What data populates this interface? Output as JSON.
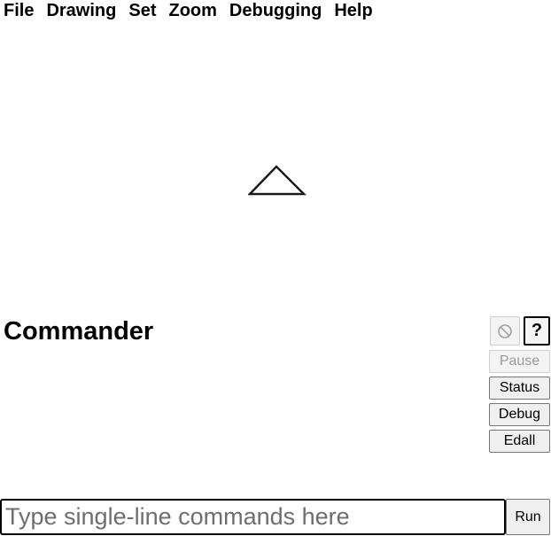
{
  "menubar": {
    "items": [
      "File",
      "Drawing",
      "Set",
      "Zoom",
      "Debugging",
      "Help"
    ]
  },
  "canvas": {
    "turtle_icon": "turtle-triangle-icon"
  },
  "commander": {
    "title": "Commander",
    "stop_icon": "no-entry-icon",
    "help_label": "?",
    "pause_label": "Pause",
    "status_label": "Status",
    "debug_label": "Debug",
    "edall_label": "Edall",
    "input_placeholder": "Type single-line commands here",
    "input_value": "",
    "run_label": "Run"
  }
}
